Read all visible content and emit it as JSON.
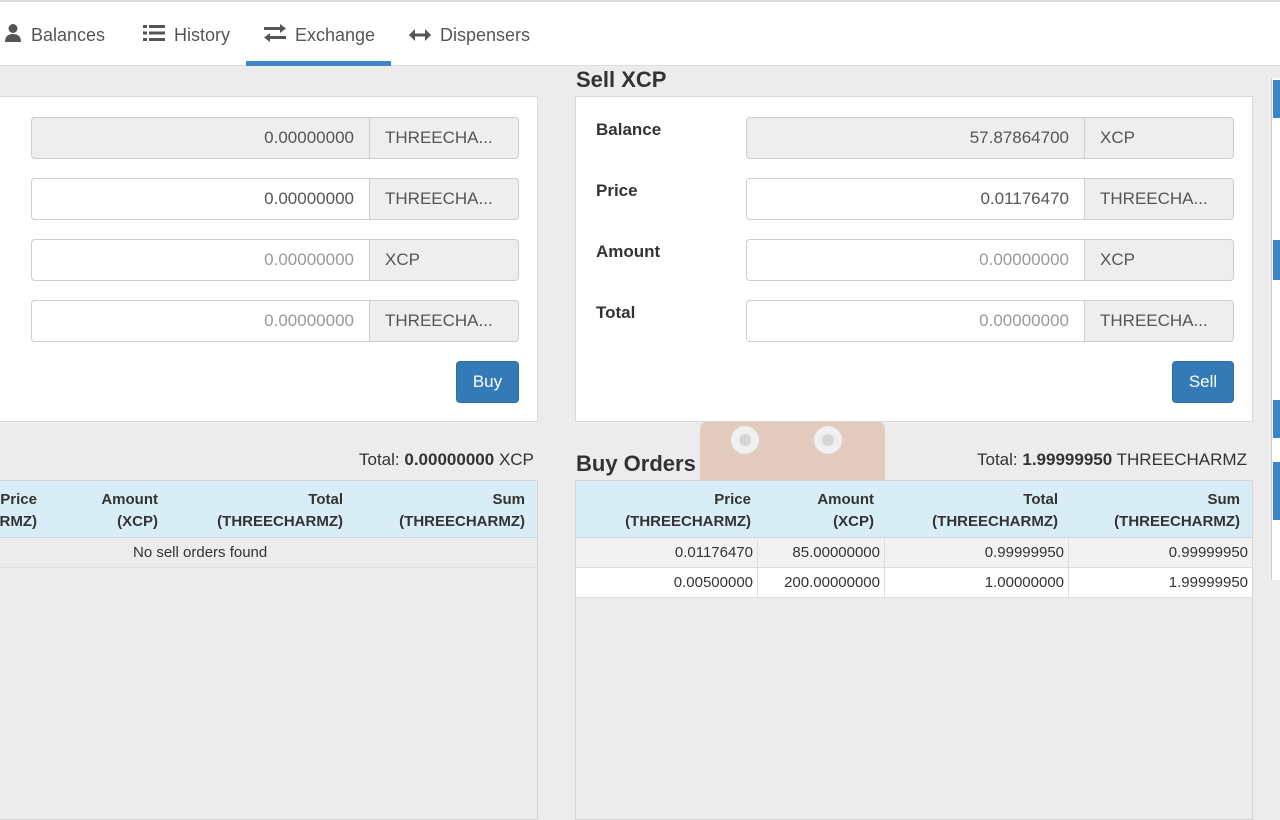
{
  "nav": {
    "tabs": [
      {
        "label": "Balances",
        "icon": "user-icon"
      },
      {
        "label": "History",
        "icon": "list-icon"
      },
      {
        "label": "Exchange",
        "icon": "exchange-icon",
        "active": true
      },
      {
        "label": "Dispensers",
        "icon": "left-right-arrow-icon"
      }
    ]
  },
  "buy_form": {
    "fields": [
      {
        "value": "0.00000000",
        "asset": "THREECHA..."
      },
      {
        "value": "0.00000000",
        "asset": "THREECHA..."
      },
      {
        "placeholder": "0.00000000",
        "asset": "XCP"
      },
      {
        "placeholder": "0.00000000",
        "asset": "THREECHA..."
      }
    ],
    "button": "Buy"
  },
  "sell_form": {
    "title": "Sell XCP",
    "fields": [
      {
        "label": "Balance",
        "value": "57.87864700",
        "asset": "XCP"
      },
      {
        "label": "Price",
        "value": "0.01176470",
        "asset": "THREECHA..."
      },
      {
        "label": "Amount",
        "placeholder": "0.00000000",
        "asset": "XCP"
      },
      {
        "label": "Total",
        "placeholder": "0.00000000",
        "asset": "THREECHA..."
      }
    ],
    "button": "Sell"
  },
  "sell_orders": {
    "total_label": "Total:",
    "total_value": "0.00000000",
    "total_unit": "XCP",
    "headers": [
      {
        "line1": "Price",
        "line2": "RMZ)"
      },
      {
        "line1": "Amount",
        "line2": "(XCP)"
      },
      {
        "line1": "Total",
        "line2": "(THREECHARMZ)"
      },
      {
        "line1": "Sum",
        "line2": "(THREECHARMZ)"
      }
    ],
    "empty_message": "No sell orders found"
  },
  "buy_orders": {
    "title": "Buy Orders",
    "total_label": "Total:",
    "total_value": "1.99999950",
    "total_unit": "THREECHARMZ",
    "headers": [
      {
        "line1": "Price",
        "line2": "(THREECHARMZ)"
      },
      {
        "line1": "Amount",
        "line2": "(XCP)"
      },
      {
        "line1": "Total",
        "line2": "(THREECHARMZ)"
      },
      {
        "line1": "Sum",
        "line2": "(THREECHARMZ)"
      }
    ],
    "rows": [
      [
        "0.01176470",
        "85.00000000",
        "0.99999950",
        "0.99999950"
      ],
      [
        "0.00500000",
        "200.00000000",
        "1.00000000",
        "1.99999950"
      ]
    ]
  },
  "colors": {
    "accent": "#337ab7",
    "table_header": "#d9edf7",
    "background": "#ececec"
  }
}
